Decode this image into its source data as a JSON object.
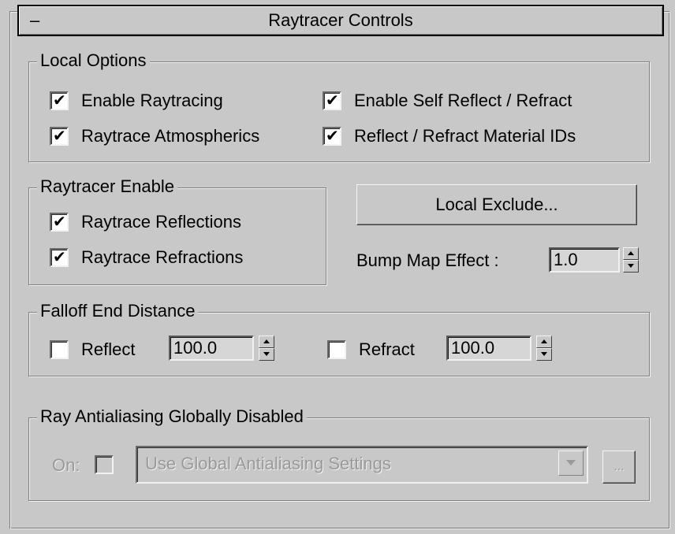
{
  "rollout": {
    "toggle": "–",
    "title": "Raytracer Controls"
  },
  "local_options": {
    "label": "Local Options",
    "enable_raytracing": {
      "label": "Enable Raytracing",
      "checked": true
    },
    "raytrace_atmospherics": {
      "label": "Raytrace Atmospherics",
      "checked": true
    },
    "enable_self_reflect_refract": {
      "label": "Enable Self Reflect / Refract",
      "checked": true
    },
    "reflect_refract_material_ids": {
      "label": "Reflect / Refract Material IDs",
      "checked": true
    }
  },
  "raytracer_enable": {
    "label": "Raytracer Enable",
    "raytrace_reflections": {
      "label": "Raytrace Reflections",
      "checked": true
    },
    "raytrace_refractions": {
      "label": "Raytrace Refractions",
      "checked": true
    }
  },
  "local_exclude_button": "Local Exclude...",
  "bump_map_effect": {
    "label": "Bump Map Effect :",
    "value": "1.0"
  },
  "falloff_end_distance": {
    "label": "Falloff End Distance",
    "reflect": {
      "label": "Reflect",
      "checked": false,
      "value": "100.0"
    },
    "refract": {
      "label": "Refract",
      "checked": false,
      "value": "100.0"
    }
  },
  "ray_antialiasing": {
    "label": "Ray Antialiasing Globally Disabled",
    "on_label": "On:",
    "on_checked": false,
    "dropdown_value": "Use Global Antialiasing Settings",
    "ellipsis_button": "..."
  },
  "check_glyph": "✔"
}
